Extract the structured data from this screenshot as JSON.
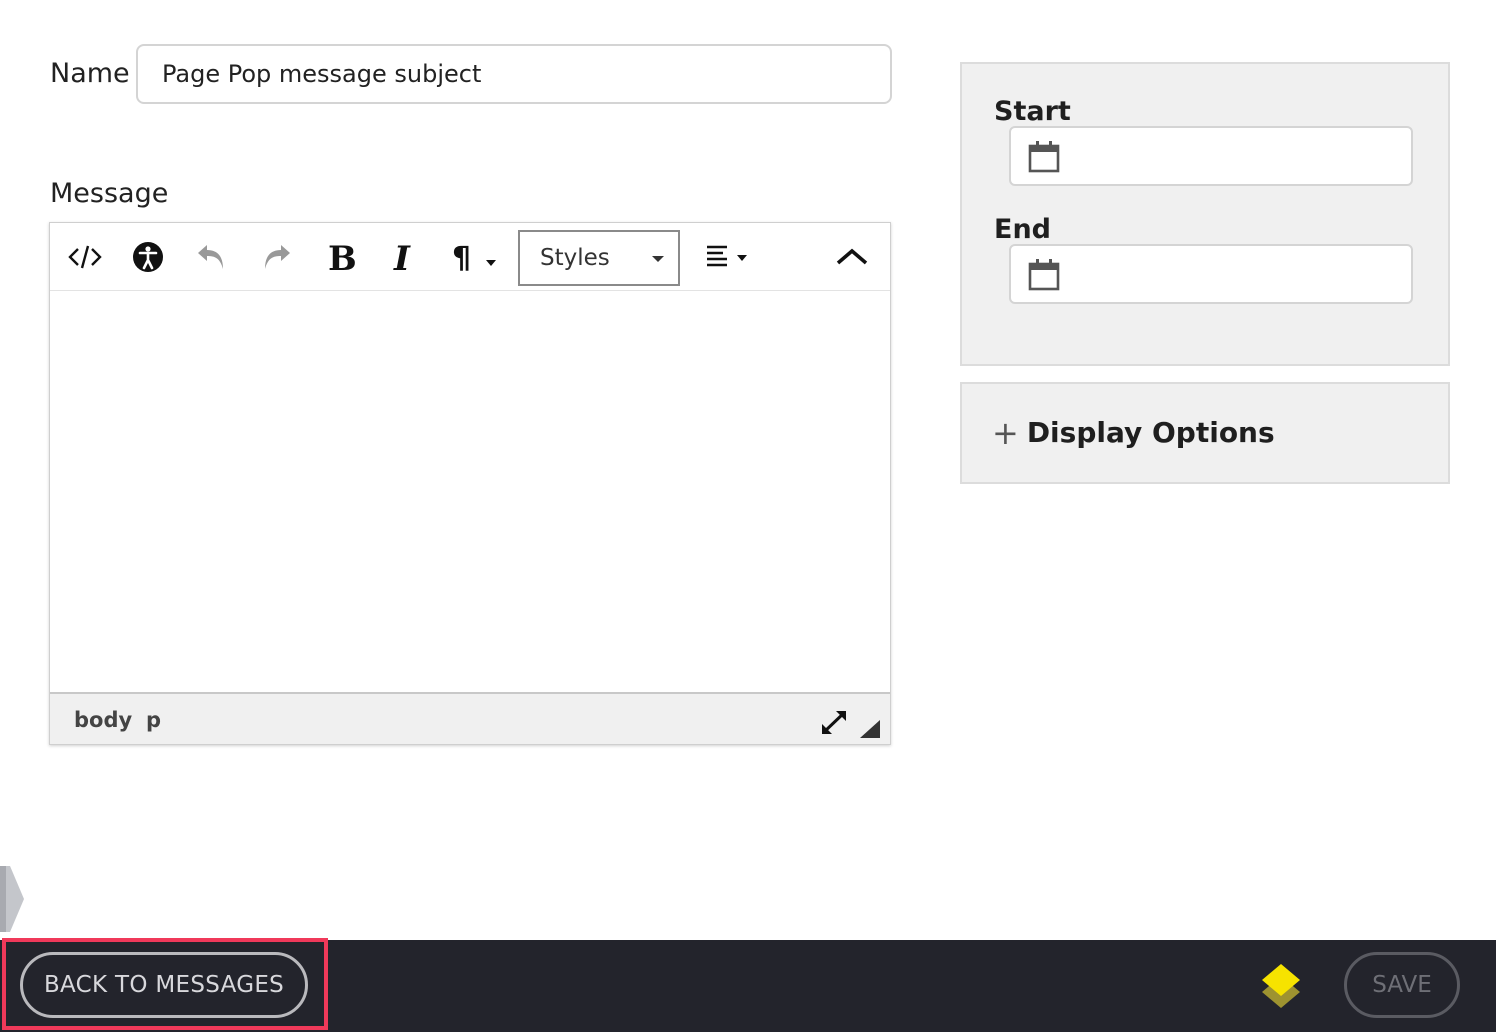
{
  "form": {
    "name_label": "Name",
    "name_value": "Page Pop message subject",
    "message_label": "Message"
  },
  "editor": {
    "toolbar": {
      "styles_label": "Styles"
    },
    "statusbar": {
      "path": [
        "body",
        "p"
      ]
    }
  },
  "schedule": {
    "start_label": "Start",
    "end_label": "End",
    "start_value": "",
    "end_value": ""
  },
  "display_options": {
    "label": "Display Options"
  },
  "footer": {
    "back_label": "BACK TO MESSAGES",
    "save_label": "SAVE"
  },
  "colors": {
    "highlight": "#f0395a",
    "footer_bg": "#23242c",
    "logo_yellow": "#f6e300"
  }
}
